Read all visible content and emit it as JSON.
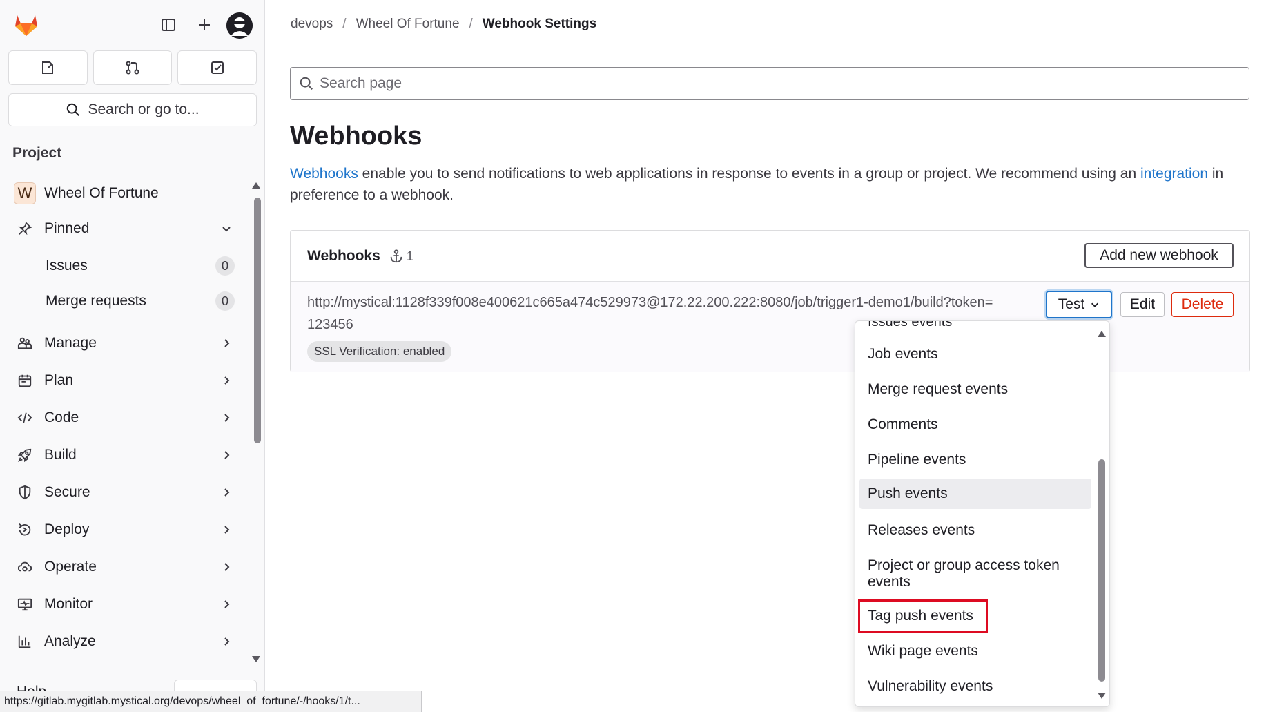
{
  "sidebar": {
    "search_label": "Search or go to...",
    "section_title": "Project",
    "project": {
      "initial": "W",
      "name": "Wheel Of Fortune"
    },
    "pinned": {
      "label": "Pinned",
      "items": [
        {
          "label": "Issues",
          "count": "0"
        },
        {
          "label": "Merge requests",
          "count": "0"
        }
      ]
    },
    "nav": [
      {
        "label": "Manage",
        "icon": "users-icon"
      },
      {
        "label": "Plan",
        "icon": "calendar-icon"
      },
      {
        "label": "Code",
        "icon": "code-icon"
      },
      {
        "label": "Build",
        "icon": "rocket-icon"
      },
      {
        "label": "Secure",
        "icon": "shield-icon"
      },
      {
        "label": "Deploy",
        "icon": "deploy-icon"
      },
      {
        "label": "Operate",
        "icon": "cloud-gear-icon"
      },
      {
        "label": "Monitor",
        "icon": "monitor-icon"
      },
      {
        "label": "Analyze",
        "icon": "chart-icon"
      }
    ],
    "help_peek": "Help"
  },
  "status_url": "https://gitlab.mygitlab.mystical.org/devops/wheel_of_fortune/-/hooks/1/t...",
  "breadcrumb": [
    "devops",
    "Wheel Of Fortune",
    "Webhook Settings"
  ],
  "search": {
    "placeholder": "Search page"
  },
  "page": {
    "title": "Webhooks",
    "desc_link1": "Webhooks",
    "desc_text1": " enable you to send notifications to web applications in response to events in a group or project. We recommend using an ",
    "desc_link2": "integration",
    "desc_text2": " in preference to a webhook."
  },
  "card": {
    "title": "Webhooks",
    "count": "1",
    "add_button": "Add new webhook",
    "hook": {
      "url": "http://mystical:1128f339f008e400621c665a474c529973@172.22.200.222:8080/job/trigger1-demo1/build?token=123456",
      "ssl": "SSL Verification: enabled"
    },
    "test_button": "Test",
    "edit_button": "Edit",
    "delete_button": "Delete"
  },
  "dropdown": {
    "cut_item": "Issues events",
    "items": [
      "Job events",
      "Merge request events",
      "Comments",
      "Pipeline events",
      "Push events",
      "Releases events",
      "Project or group access token events",
      "Tag push events",
      "Wiki page events",
      "Vulnerability events"
    ],
    "active_item": "Push events",
    "highlighted_item": "Tag push events"
  },
  "colors": {
    "link": "#1f75cb",
    "danger": "#dd2b0e",
    "highlight_box": "#dd0b22"
  }
}
